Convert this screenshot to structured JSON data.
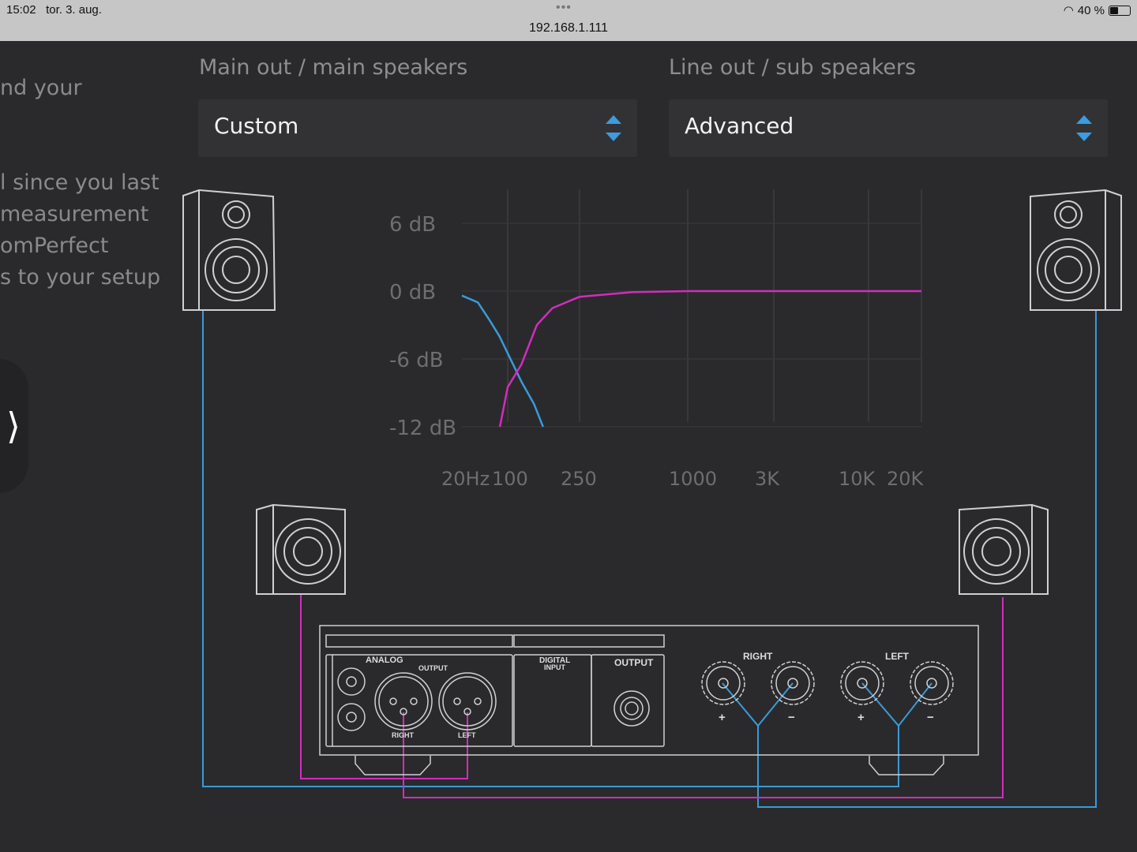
{
  "status_bar": {
    "time": "15:02",
    "date": "tor. 3. aug.",
    "url": "192.168.1.111",
    "battery": "40 %",
    "battery_level": 40
  },
  "side_panel": {
    "lines": [
      "nd your",
      "l since you last",
      "measurement",
      "omPerfect",
      "s to your setup"
    ],
    "expand_glyph": "⟩"
  },
  "main_out": {
    "title": "Main out / main speakers",
    "selected": "Custom"
  },
  "line_out": {
    "title": "Line out / sub speakers",
    "selected": "Advanced"
  },
  "colors": {
    "main": "#d22cc0",
    "sub": "#3a9ad9",
    "accent": "#3d9be0"
  },
  "chart_data": {
    "type": "line",
    "y_ticks": [
      "6 dB",
      "0 dB",
      "-6 dB",
      "-12 dB"
    ],
    "y_values": [
      6,
      0,
      -6,
      -12
    ],
    "x_ticks": [
      "20Hz",
      "100",
      "250",
      "1000",
      "3K",
      "10K",
      "20K"
    ],
    "x_values": [
      20,
      100,
      250,
      1000,
      3000,
      10000,
      20000
    ],
    "ylim": [
      -12,
      6
    ],
    "series": [
      {
        "name": "sub low-pass",
        "color": "#3a9ad9",
        "points": [
          [
            20,
            -0.4
          ],
          [
            35,
            -1
          ],
          [
            52,
            -2.5
          ],
          [
            75,
            -4
          ],
          [
            100,
            -5.5
          ],
          [
            119,
            -8
          ],
          [
            140,
            -10
          ],
          [
            157,
            -12
          ]
        ]
      },
      {
        "name": "main high-pass",
        "color": "#d22cc0",
        "points": [
          [
            76,
            -12
          ],
          [
            100,
            -8.5
          ],
          [
            119,
            -6.5
          ],
          [
            145,
            -3
          ],
          [
            177,
            -1.5
          ],
          [
            250,
            -0.5
          ],
          [
            488,
            -0.1
          ],
          [
            1000,
            0
          ],
          [
            20000,
            0
          ]
        ]
      }
    ]
  },
  "amplifier": {
    "analog": "ANALOG",
    "output": "OUTPUT",
    "right": "RIGHT",
    "left": "LEFT",
    "digital_input_1": "DIGITAL",
    "digital_input_2": "INPUT",
    "digital_output": "OUTPUT",
    "spk_right": "RIGHT",
    "spk_left": "LEFT",
    "plus": "+",
    "minus": "−"
  }
}
